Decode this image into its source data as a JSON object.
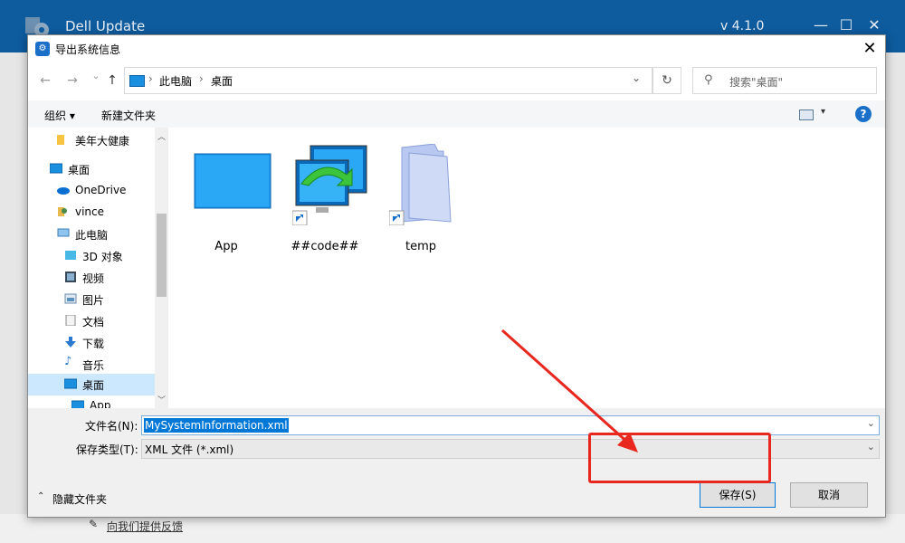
{
  "bg_app": {
    "title": "Dell Update",
    "version": "v 4.1.0",
    "feedback": "向我们提供反馈"
  },
  "dialog": {
    "title": "导出系统信息",
    "close": "✕"
  },
  "nav": {
    "back": "←",
    "forward": "→",
    "recent": "⌄",
    "up": "↑",
    "crumbs": [
      "此电脑",
      "桌面"
    ],
    "refresh": "↻",
    "search_placeholder": "搜索\"桌面\""
  },
  "toolbar": {
    "organize": "组织 ▾",
    "new_folder": "新建文件夹",
    "help": "?"
  },
  "nav_pane": [
    {
      "label": "美年大健康",
      "icon": "folder-icon"
    },
    {
      "label": "桌面",
      "icon": "desktop-icon"
    },
    {
      "label": "OneDrive",
      "icon": "cloud-icon"
    },
    {
      "label": "vince",
      "icon": "user-icon"
    },
    {
      "label": "此电脑",
      "icon": "computer-icon"
    },
    {
      "label": "3D 对象",
      "icon": "cube-icon"
    },
    {
      "label": "视频",
      "icon": "video-icon"
    },
    {
      "label": "图片",
      "icon": "picture-icon"
    },
    {
      "label": "文档",
      "icon": "document-icon"
    },
    {
      "label": "下载",
      "icon": "download-icon"
    },
    {
      "label": "音乐",
      "icon": "music-icon"
    },
    {
      "label": "桌面",
      "icon": "desktop-icon"
    },
    {
      "label": "App",
      "icon": "desktop-icon"
    }
  ],
  "files": [
    {
      "label": "App",
      "icon": "desktop-folder-icon"
    },
    {
      "label": "##code##",
      "icon": "network-shortcut-icon"
    },
    {
      "label": "temp",
      "icon": "folder-shortcut-icon"
    }
  ],
  "form": {
    "filename_label": "文件名(N):",
    "filename_value": "MySystemInformation.xml",
    "filetype_label": "保存类型(T):",
    "filetype_value": "XML 文件 (*.xml)",
    "hide_folders": "隐藏文件夹",
    "save": "保存(S)",
    "cancel": "取消"
  },
  "colors": {
    "accent": "#0078d7",
    "highlight": "#e8281e"
  }
}
